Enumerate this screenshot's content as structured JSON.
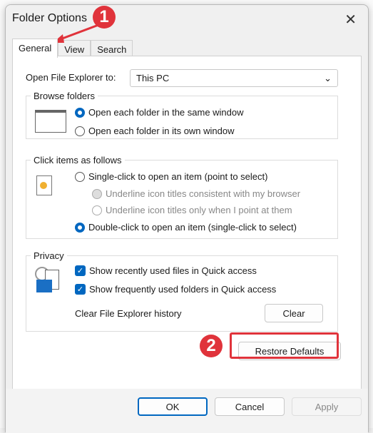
{
  "dialog": {
    "title": "Folder Options",
    "close_icon": "close-icon"
  },
  "tabs": [
    {
      "label": "General",
      "active": true
    },
    {
      "label": "View"
    },
    {
      "label": "Search"
    }
  ],
  "open_to": {
    "label": "Open File Explorer to:",
    "value": "This PC"
  },
  "browse": {
    "legend": "Browse folders",
    "options": [
      {
        "label": "Open each folder in the same window",
        "selected": true
      },
      {
        "label": "Open each folder in its own window",
        "selected": false
      }
    ]
  },
  "click": {
    "legend": "Click items as follows",
    "single": "Single-click to open an item (point to select)",
    "underline_browser": "Underline icon titles consistent with my browser",
    "underline_point": "Underline icon titles only when I point at them",
    "double": "Double-click to open an item (single-click to select)"
  },
  "privacy": {
    "legend": "Privacy",
    "recent": "Show recently used files in Quick access",
    "frequent": "Show frequently used folders in Quick access",
    "clear_label": "Clear File Explorer history",
    "clear_button": "Clear"
  },
  "restore_button": "Restore Defaults",
  "footer": {
    "ok": "OK",
    "cancel": "Cancel",
    "apply": "Apply"
  },
  "annotations": {
    "step1": "1",
    "step2": "2",
    "color": "#e0333b"
  },
  "accent": "#0067c0"
}
